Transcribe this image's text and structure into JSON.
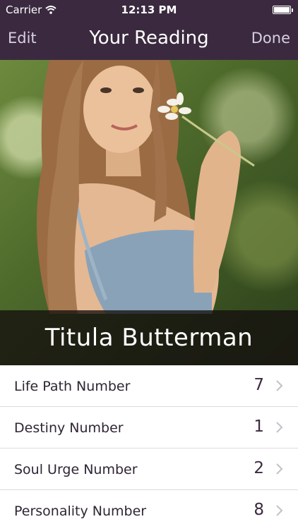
{
  "status_bar": {
    "carrier": "Carrier",
    "time": "12:13 PM"
  },
  "nav": {
    "edit_label": "Edit",
    "title": "Your Reading",
    "done_label": "Done"
  },
  "profile": {
    "name": "Titula Butterman"
  },
  "numbers": [
    {
      "label": "Life Path Number",
      "value": "7"
    },
    {
      "label": "Destiny Number",
      "value": "1"
    },
    {
      "label": "Soul Urge Number",
      "value": "2"
    },
    {
      "label": "Personality Number",
      "value": "8"
    }
  ],
  "colors": {
    "nav_background": "#3b2a3f",
    "accent": "#3b2a3f",
    "divider": "#dedbe0"
  },
  "icons": {
    "wifi": "wifi-icon",
    "battery": "battery-icon",
    "disclosure": "chevron-right-icon"
  }
}
